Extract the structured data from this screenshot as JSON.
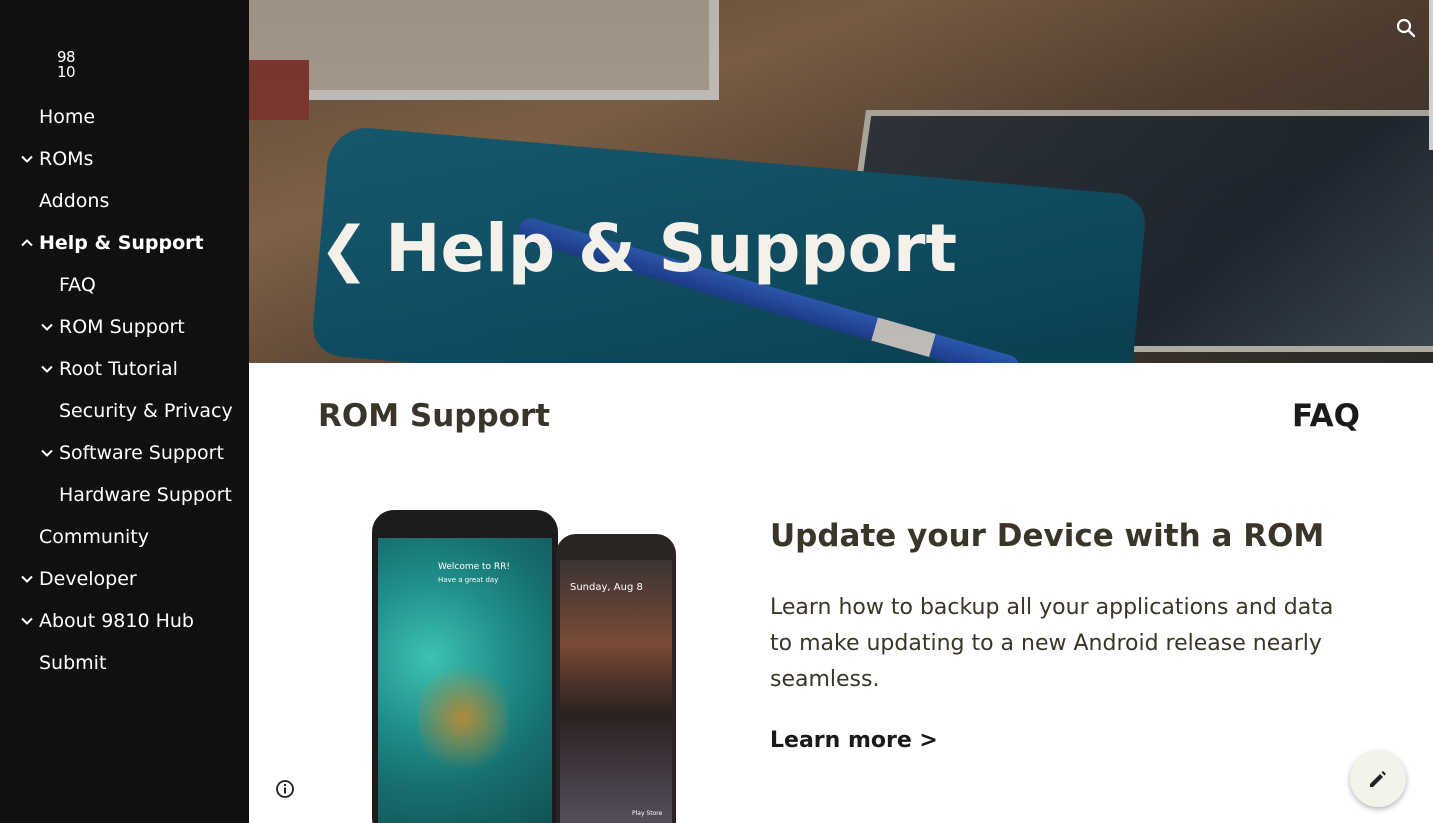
{
  "site": {
    "logo_line1": "98",
    "logo_line2": "10"
  },
  "nav": {
    "home": "Home",
    "roms": "ROMs",
    "addons": "Addons",
    "help_support": "Help & Support",
    "faq": "FAQ",
    "rom_support": "ROM Support",
    "root_tutorial": "Root Tutorial",
    "security_privacy": "Security & Privacy",
    "software_support": "Software Support",
    "hardware_support": "Hardware Support",
    "community": "Community",
    "developer": "Developer",
    "about": "About 9810 Hub",
    "submit": "Submit"
  },
  "hero": {
    "back_glyph": "❮",
    "title": "Help & Support"
  },
  "content": {
    "rom_support_heading": "ROM Support",
    "faq_heading": "FAQ",
    "card_title": "Update your Device with a ROM",
    "card_description": "Learn how to backup all your applications and data to make updating to a new Android release nearly seamless.",
    "learn_more": "Learn more >"
  },
  "phones": {
    "welcome": "Welcome to RR!",
    "greeting": "Have a great day",
    "date": "Sunday, Aug 8",
    "store": "Play Store"
  },
  "colors": {
    "sidebar_bg": "#0f1110",
    "heading": "#3a3529",
    "hero_text": "#f3f1ea"
  },
  "icons": {
    "search": "search-icon",
    "info": "info-icon",
    "edit": "pencil-icon",
    "chevron": "chevron-down-icon"
  }
}
